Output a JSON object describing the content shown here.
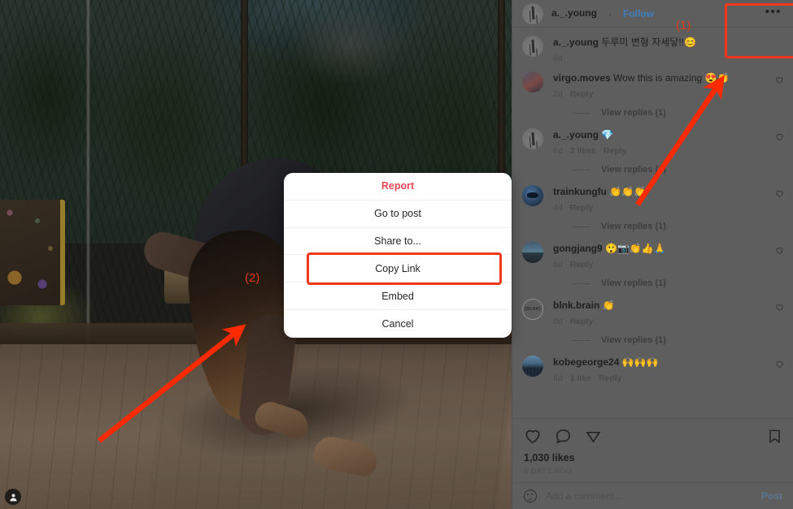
{
  "post": {
    "author": "a._.young",
    "separator": "·",
    "follow_label": "Follow",
    "more_icon": "•••",
    "likes": "1,030 likes",
    "timestamp": "6 DAYS AGO"
  },
  "comments": [
    {
      "author": "a._.young",
      "text": " 두루미 변형 자세닿!!😊",
      "time": "6d",
      "likes": "",
      "reply_label": "",
      "view_replies": "",
      "avatar": "av-aong",
      "has_heart": false
    },
    {
      "author": "virgo.moves",
      "text": " Wow this is amazing 😍👏",
      "time": "2d",
      "likes": "",
      "reply_label": "Reply",
      "view_replies": "View replies (1)",
      "avatar": "av-virgo",
      "has_heart": true
    },
    {
      "author": "a._.young",
      "text": " 💎",
      "time": "6d",
      "likes": "2 likes",
      "reply_label": "Reply",
      "view_replies": "View replies (1)",
      "avatar": "av-aong",
      "has_heart": true
    },
    {
      "author": "trainkungfu",
      "text": " 👏👏👏",
      "time": "4d",
      "likes": "",
      "reply_label": "Reply",
      "view_replies": "View replies (1)",
      "avatar": "av-train",
      "has_heart": true
    },
    {
      "author": "gongjang9",
      "text": " 😲📷👏👍🙏",
      "time": "6d",
      "likes": "",
      "reply_label": "Reply",
      "view_replies": "View replies (1)",
      "avatar": "av-gong",
      "has_heart": true
    },
    {
      "author": "blnk.brain",
      "text": " 👏",
      "time": "6d",
      "likes": "",
      "reply_label": "Reply",
      "view_replies": "View replies (1)",
      "avatar": "av-blnk",
      "has_heart": true
    },
    {
      "author": "kobegeorge24",
      "text": " 🙌🙌🙌",
      "time": "6d",
      "likes": "1 like",
      "reply_label": "Reply",
      "view_replies": "",
      "avatar": "av-kobe",
      "has_heart": true
    }
  ],
  "composer": {
    "placeholder": "Add a comment...",
    "value": "",
    "post_label": "Post"
  },
  "modal": {
    "items": [
      {
        "label": "Report",
        "style": "danger"
      },
      {
        "label": "Go to post",
        "style": "normal"
      },
      {
        "label": "Share to...",
        "style": "normal"
      },
      {
        "label": "Copy Link",
        "style": "normal"
      },
      {
        "label": "Embed",
        "style": "normal"
      },
      {
        "label": "Cancel",
        "style": "normal"
      }
    ]
  },
  "annotations": {
    "step_1": "(1)",
    "step_2": "(2)",
    "highlight_color": "#f2371a",
    "arrow_color": "#ff2a00"
  }
}
